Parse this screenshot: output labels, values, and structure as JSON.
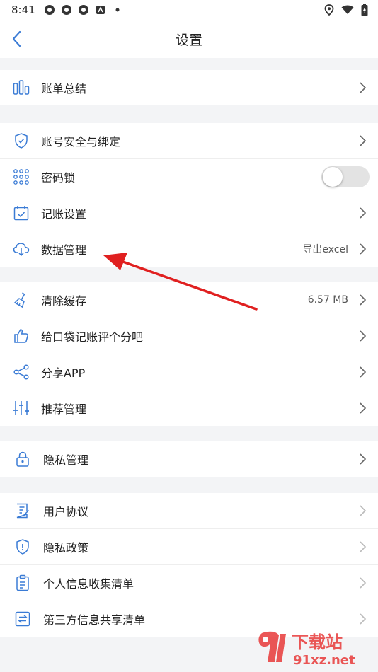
{
  "status_bar": {
    "time": "8:41"
  },
  "header": {
    "title": "设置"
  },
  "groups": {
    "g1": [
      {
        "label": "账单总结"
      }
    ],
    "g2": [
      {
        "label": "账号安全与绑定"
      },
      {
        "label": "密码锁"
      },
      {
        "label": "记账设置"
      },
      {
        "label": "数据管理",
        "value": "导出excel"
      }
    ],
    "g3": [
      {
        "label": "清除缓存",
        "value": "6.57 MB"
      },
      {
        "label": "给口袋记账评个分吧"
      },
      {
        "label": "分享APP"
      },
      {
        "label": "推荐管理"
      }
    ],
    "g4": [
      {
        "label": "隐私管理"
      }
    ],
    "g5": [
      {
        "label": "用户协议"
      },
      {
        "label": "隐私政策"
      },
      {
        "label": "个人信息收集清单"
      },
      {
        "label": "第三方信息共享清单"
      }
    ]
  },
  "password_lock_enabled": false,
  "accent_color": "#3a7bd5",
  "annotation_color": "#e02020",
  "watermark": {
    "text_cn": "下载站",
    "domain": "91xz.net"
  }
}
